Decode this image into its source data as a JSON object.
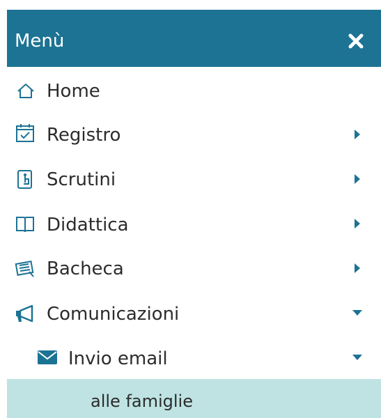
{
  "header": {
    "title": "Menù",
    "close_icon": "close-icon",
    "background": "#1c7393"
  },
  "menu": {
    "home": {
      "label": "Home",
      "icon": "home-icon"
    },
    "registro": {
      "label": "Registro",
      "icon": "calendar-check-icon",
      "state": "collapsed"
    },
    "scrutini": {
      "label": "Scrutini",
      "icon": "tablet-hand-icon",
      "state": "collapsed"
    },
    "didattica": {
      "label": "Didattica",
      "icon": "open-book-icon",
      "state": "collapsed"
    },
    "bacheca": {
      "label": "Bacheca",
      "icon": "notice-board-icon",
      "state": "collapsed"
    },
    "comunicazioni": {
      "label": "Comunicazioni",
      "icon": "megaphone-icon",
      "state": "expanded"
    },
    "invio_email": {
      "label": "Invio email",
      "icon": "envelope-icon",
      "state": "expanded"
    },
    "alle_famiglie": {
      "label": "alle famiglie",
      "state": "selected"
    }
  },
  "colors": {
    "accent": "#1c7393",
    "selected_bg": "#bfe3e3",
    "text": "#2c2c2c"
  }
}
